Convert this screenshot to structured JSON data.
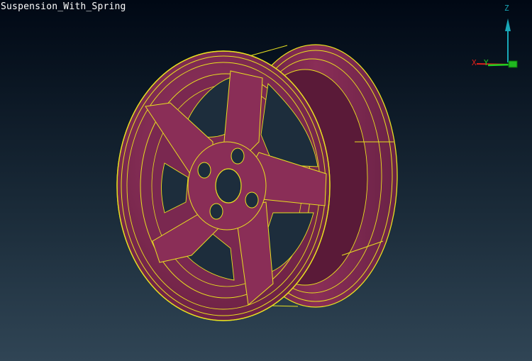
{
  "window": {
    "model_title": "Suspension_With_Spring"
  },
  "axes": {
    "x_label": "X",
    "y_label": "Y",
    "z_label": "Z",
    "x_color": "#e0201a",
    "y_color": "#20d020",
    "z_color": "#18a8b8"
  },
  "model": {
    "name": "wheel-rim",
    "face_color": "#8a2e57",
    "edge_color": "#e8e020"
  }
}
